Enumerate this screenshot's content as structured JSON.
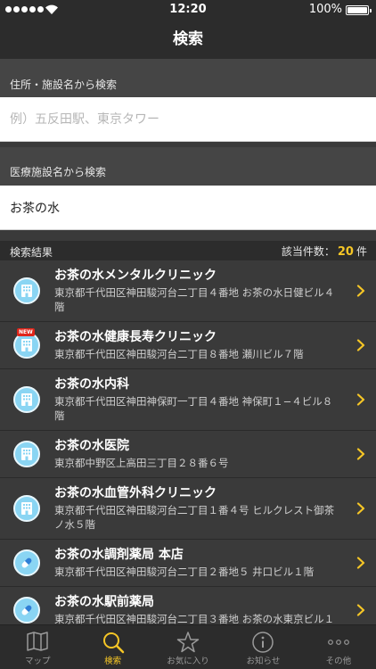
{
  "status": {
    "time": "12:20",
    "battery": "100%"
  },
  "nav": {
    "title": "検索"
  },
  "address_search": {
    "label": "住所・施設名から検索",
    "placeholder": "例）五反田駅、東京タワー",
    "value": ""
  },
  "facility_search": {
    "label": "医療施設名から検索",
    "value": "お茶の水"
  },
  "results": {
    "label": "検索結果",
    "count_prefix": "該当件数：",
    "count": "20",
    "count_suffix": "件",
    "items": [
      {
        "name": "お茶の水メンタルクリニック",
        "address": "東京都千代田区神田駿河台二丁目４番地 お茶の水日健ビル４階",
        "icon": "hospital-icon"
      },
      {
        "name": "お茶の水健康長寿クリニック",
        "address": "東京都千代田区神田駿河台二丁目８番地 瀬川ビル７階",
        "icon": "hospital-icon",
        "badge": "NEW"
      },
      {
        "name": "お茶の水内科",
        "address": "東京都千代田区神田神保町一丁目４番地 神保町１−４ビル８階",
        "icon": "hospital-icon"
      },
      {
        "name": "お茶の水医院",
        "address": "東京都中野区上高田三丁目２８番６号",
        "icon": "hospital-icon"
      },
      {
        "name": "お茶の水血管外科クリニック",
        "address": "東京都千代田区神田駿河台二丁目１番４号 ヒルクレスト御茶ノ水５階",
        "icon": "hospital-icon"
      },
      {
        "name": "お茶の水調剤薬局 本店",
        "address": "東京都千代田区神田駿河台二丁目２番地５ 井口ビル１階",
        "icon": "pill-icon"
      },
      {
        "name": "お茶の水駅前薬局",
        "address": "東京都千代田区神田駿河台二丁目３番地 お茶の水東京ビル１",
        "icon": "pill-icon"
      }
    ]
  },
  "tabs": [
    {
      "label": "マップ",
      "icon": "map-icon",
      "active": false
    },
    {
      "label": "検索",
      "icon": "search-icon",
      "active": true
    },
    {
      "label": "お気に入り",
      "icon": "star-icon",
      "active": false
    },
    {
      "label": "お知らせ",
      "icon": "info-icon",
      "active": false
    },
    {
      "label": "その他",
      "icon": "more-icon",
      "active": false
    }
  ],
  "colors": {
    "accent": "#f6c626",
    "bar": "#2c2c2c",
    "list_bg": "#3a3a3a",
    "icon_bg": "#8ad5f3",
    "badge": "#e0251a"
  }
}
